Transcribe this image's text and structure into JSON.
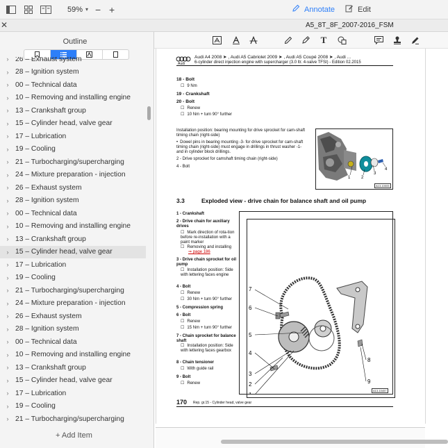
{
  "toolbar": {
    "zoom_label": "59%",
    "annotate_label": "Annotate",
    "edit_label": "Edit",
    "icons": [
      "sidebar-toggle-icon",
      "grid-icon",
      "two-page-icon"
    ]
  },
  "document": {
    "title": "A5_8T_8F_2007-2016_FSM"
  },
  "sidebar": {
    "title": "Outline",
    "tabs": [
      "bookmark",
      "list",
      "text",
      "page"
    ],
    "add_item_label": "+ Add Item",
    "items": [
      "26 – Exhaust system",
      "28 – Ignition system",
      "00 – Technical data",
      "10 – Removing and installing engine",
      "13 – Crankshaft group",
      "15 – Cylinder head, valve gear",
      "17 – Lubrication",
      "19 – Cooling",
      "21 – Turbocharging/supercharging",
      "24 – Mixture preparation - injection",
      "26 – Exhaust system",
      "28 – Ignition system",
      "00 – Technical data",
      "10 – Removing and installing engine",
      "13 – Crankshaft group",
      "15 – Cylinder head, valve gear",
      "17 – Lubrication",
      "19 – Cooling",
      "21 – Turbocharging/supercharging",
      "24 – Mixture preparation - injection",
      "26 – Exhaust system",
      "28 – Ignition system",
      "00 – Technical data",
      "10 – Removing and installing engine",
      "13 – Crankshaft group",
      "15 – Cylinder head, valve gear",
      "17 – Lubrication",
      "19 – Cooling",
      "21 – Turbocharging/supercharging"
    ],
    "selected_index": 15
  },
  "page": {
    "header_models": "Audi A4 2008 ➤ , Audi A5 Cabriolet 2009 ➤ , Audi A5 Coupé 2008 ➤ , Audi ...",
    "header_engine": "6-cylinder direct injection engine with supercharger (3.0 ltr. 4-valve TFSI) - Edition 02.2015",
    "brand": "Audi",
    "items_top": [
      {
        "title": "18 - Bolt",
        "notes": [
          "9 Nm"
        ]
      },
      {
        "title": "19 - Crankshaft",
        "notes": []
      },
      {
        "title": "20 - Bolt",
        "notes": [
          "Renew",
          "10 Nm + turn 90° further"
        ]
      }
    ],
    "install_heading": "Installation position: bearing mounting for drive sprocket for cam-shaft timing chain (right-side)",
    "install_bullet": "Dowel pins in bearing mounting -3- for drive sprocket for cam-shaft timing chain (right-side) must engage in drillings in thrust washer -1- and in cylinder block drillings.",
    "install_items": [
      "2 - Drive sprocket for camshaft timing chain (right-side)",
      "4 - Bolt"
    ],
    "fig1_id": "A13-10005",
    "fig1_callouts": [
      "1",
      "2",
      "3",
      "4"
    ],
    "section_number": "3.3",
    "section_title": "Exploded view - drive chain for balance shaft and oil pump",
    "parts": [
      {
        "title": "1 - Crankshaft",
        "notes": []
      },
      {
        "title": "2 - Drive chain for auxiliary drives",
        "notes": [
          "Mark direction of rota-tion before re-installation with a paint marker",
          "Removing and installing"
        ],
        "link": "⇒ page 186"
      },
      {
        "title": "3 - Drive chain sprocket for oil pump",
        "notes": [
          "Installation position: Side with lettering faces engine"
        ]
      },
      {
        "title": "4 - Bolt",
        "notes": [
          "Renew",
          "30 Nm + turn 90° further"
        ]
      },
      {
        "title": "5 - Compression spring",
        "notes": []
      },
      {
        "title": "6 - Bolt",
        "notes": [
          "Renew",
          "15 Nm + turn 90° further"
        ]
      },
      {
        "title": "7 - Chain sprocket for balance shaft",
        "notes": [
          "Installation position: Side with lettering faces gearbox"
        ]
      },
      {
        "title": "8 - Chain tensioner",
        "notes": [
          "With guide rail"
        ]
      },
      {
        "title": "9 - Bolt",
        "notes": [
          "Renew"
        ]
      }
    ],
    "fig2_callouts": [
      "7",
      "6",
      "5",
      "4",
      "3",
      "2",
      "1",
      "8",
      "9"
    ],
    "fig2_id": "A13-10457",
    "page_number": "170",
    "footer": "Rep. gr.15 - Cylinder head, valve gear"
  }
}
